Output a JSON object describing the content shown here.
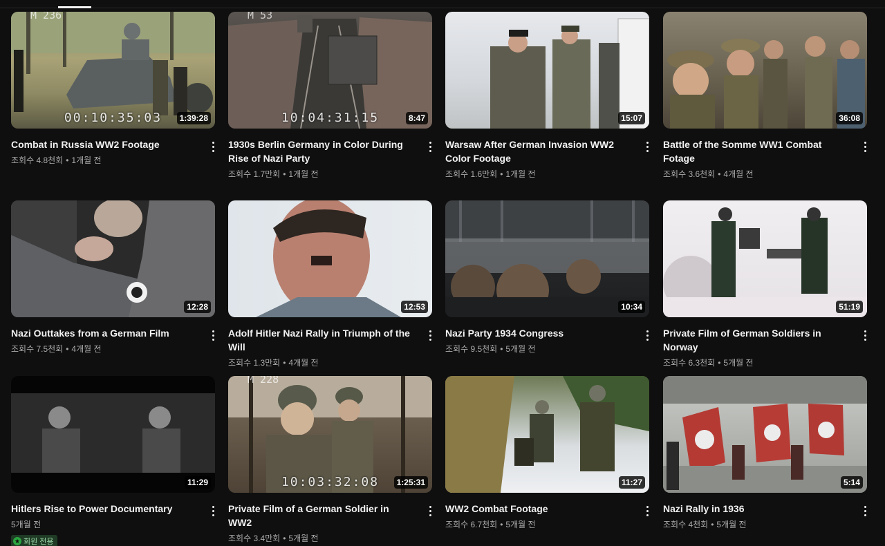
{
  "videos": [
    {
      "title": "Combat in Russia WW2 Footage",
      "views": "조회수 4.8천회",
      "age": "1개월 전",
      "duration": "1:39:28",
      "timecode": "00:10:35:03",
      "tag": "M 236"
    },
    {
      "title": "1930s Berlin Germany in Color During Rise of Nazi Party",
      "views": "조회수 1.7만회",
      "age": "1개월 전",
      "duration": "8:47",
      "timecode": "10:04:31:15",
      "tag": "M 53"
    },
    {
      "title": "Warsaw After German Invasion WW2 Color Footage",
      "views": "조회수 1.6만회",
      "age": "1개월 전",
      "duration": "15:07",
      "timecode": "",
      "tag": ""
    },
    {
      "title": "Battle of the Somme WW1 Combat Fotage",
      "views": "조회수 3.6천회",
      "age": "4개월 전",
      "duration": "36:08",
      "timecode": "",
      "tag": ""
    },
    {
      "title": "Nazi Outtakes from a German Film",
      "views": "조회수 7.5천회",
      "age": "4개월 전",
      "duration": "12:28",
      "timecode": "",
      "tag": ""
    },
    {
      "title": "Adolf Hitler Nazi Rally in Triumph of the Will",
      "views": "조회수 1.3만회",
      "age": "4개월 전",
      "duration": "12:53",
      "timecode": "",
      "tag": ""
    },
    {
      "title": "Nazi Party 1934 Congress",
      "views": "조회수 9.5천회",
      "age": "5개월 전",
      "duration": "10:34",
      "timecode": "",
      "tag": ""
    },
    {
      "title": "Private Film of German Soldiers in Norway",
      "views": "조회수 6.3천회",
      "age": "5개월 전",
      "duration": "51:19",
      "timecode": "",
      "tag": ""
    },
    {
      "title": "Hitlers Rise to Power Documentary",
      "views": "",
      "age": "5개월 전",
      "duration": "11:29",
      "timecode": "",
      "tag": "",
      "badge": "회원 전용"
    },
    {
      "title": "Private Film of a German Soldier in WW2",
      "views": "조회수 3.4만회",
      "age": "5개월 전",
      "duration": "1:25:31",
      "timecode": "10:03:32:08",
      "tag": "M 228"
    },
    {
      "title": "WW2 Combat Footage",
      "views": "조회수 6.7천회",
      "age": "5개월 전",
      "duration": "11:27",
      "timecode": "",
      "tag": ""
    },
    {
      "title": "Nazi Rally in 1936",
      "views": "조회수 4천회",
      "age": "5개월 전",
      "duration": "5:14",
      "timecode": "",
      "tag": ""
    }
  ],
  "icons": {
    "more": "more-vert-icon",
    "members": "star-badge-icon"
  },
  "colors": {
    "background": "#0f0f0f",
    "text": "#f1f1f1",
    "meta": "#aaaaaa",
    "members_badge": "#2ba640"
  }
}
